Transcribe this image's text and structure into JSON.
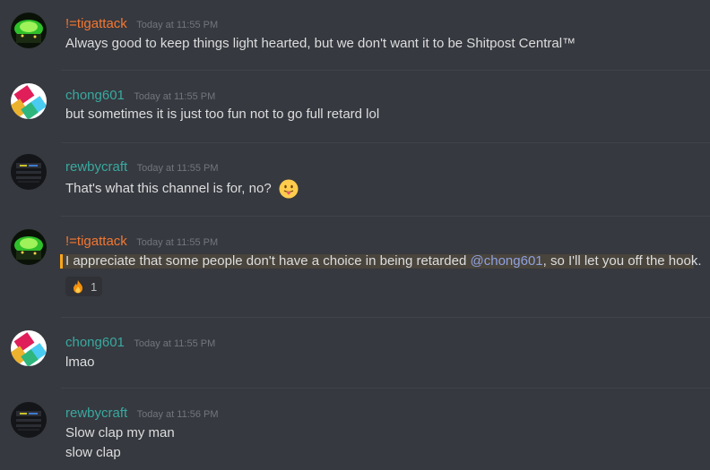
{
  "messages": [
    {
      "username": "!=tigattack",
      "timestamp": "Today at 11:55 PM",
      "lines": [
        "Always good to keep things light hearted, but we don't want it to be Shitpost Central™"
      ]
    },
    {
      "username": "chong601",
      "timestamp": "Today at 11:55 PM",
      "lines": [
        "but sometimes it is just too fun not to go full retard lol"
      ]
    },
    {
      "username": "rewbycraft",
      "timestamp": "Today at 11:55 PM",
      "lines": [
        "That's what this channel is for, no?"
      ],
      "emoji": "stuck-out-tongue-emoji"
    },
    {
      "username": "!=tigattack",
      "timestamp": "Today at 11:55 PM",
      "text_before": "I appreciate that some people don't have a choice in being retarded ",
      "mention": "@chong601",
      "text_after": ", so I'll let you off the hook.",
      "reaction": {
        "icon": "fire-emoji",
        "count": "1"
      }
    },
    {
      "username": "chong601",
      "timestamp": "Today at 11:55 PM",
      "lines": [
        "lmao"
      ]
    },
    {
      "username": "rewbycraft",
      "timestamp": "Today at 11:56 PM",
      "lines": [
        "Slow clap my man",
        "slow clap"
      ]
    }
  ],
  "colors": {
    "background": "#36393f",
    "orange_user": "#f57731",
    "teal_user": "#39a9a0",
    "mention": "#8ea1e1",
    "mention_highlight": "#49443c",
    "mention_bar": "#faa61a"
  }
}
